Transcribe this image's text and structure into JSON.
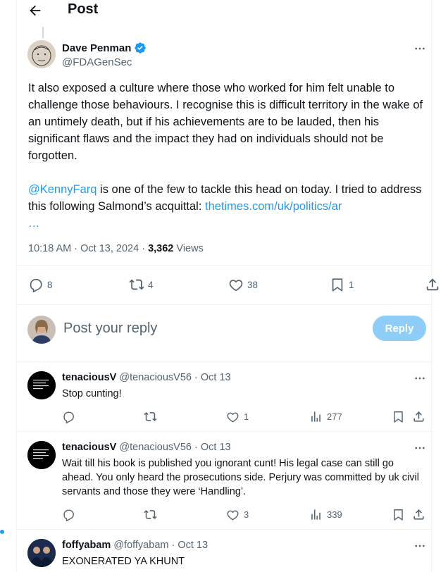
{
  "header": {
    "title": "Post"
  },
  "post": {
    "author_name": "Dave Penman",
    "author_handle": "@FDAGenSec",
    "paragraph1": "It also exposed a culture where those who worked for him felt unable to challenge those behaviours. I recognise this is difficult territory in the wake of an untimely death, but if his achievements are to be lauded, then his significant flaws and the impact they had on individuals should not be forgotten.",
    "mention": "@KennyFarq",
    "paragraph2_text": " is one of the few to tackle this head on today. I tried to address this following Salmond’s acquittal: ",
    "link": "thetimes.com/uk/politics/ar",
    "link_cont": "…",
    "time": "10:18 AM · Oct 13, 2024",
    "views_sep": " · ",
    "views_count": "3,362",
    "views_label": " Views",
    "stats": {
      "replies": "8",
      "reposts": "4",
      "likes": "38",
      "bookmarks": "1"
    }
  },
  "composer": {
    "placeholder": "Post your reply",
    "button": "Reply"
  },
  "comments": [
    {
      "name": "tenaciousV",
      "handle": "@tenaciousV56 · Oct 13",
      "text": "Stop cunting!",
      "replies": "",
      "reposts": "",
      "likes": "1",
      "views": "277"
    },
    {
      "name": "tenaciousV",
      "handle": "@tenaciousV56 · Oct 13",
      "text": "Wait till his book is published you ignorant cunt! His legal case can still go ahead. You only heard the prosecutions side. Perjury was committed by uk civil servants and those they were ‘Handling’.",
      "replies": "",
      "reposts": "",
      "likes": "3",
      "views": "339"
    },
    {
      "name": "foffyabam",
      "handle": "@foffyabam · Oct 13",
      "text": "EXONERATED YA KHUNT"
    }
  ],
  "colors": {
    "accent": "#1d9bf0",
    "reply_button_disabled": "#8ecdf7",
    "secondary_text": "#536471"
  }
}
